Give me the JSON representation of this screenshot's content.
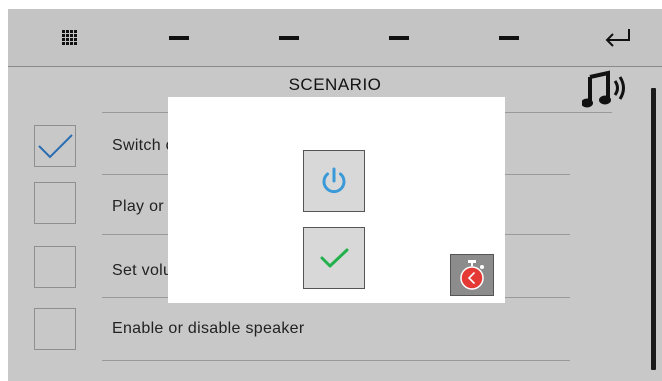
{
  "toolbar": {
    "items": [
      "grid-icon",
      "dash",
      "dash",
      "dash",
      "dash",
      "return-icon"
    ]
  },
  "header": {
    "title": "SCENARIO",
    "icon": "music-speaker-icon"
  },
  "list": {
    "items": [
      {
        "label": "Switch on or off",
        "checked": true
      },
      {
        "label": "Play or stop",
        "checked": false
      },
      {
        "label": "Set volume",
        "checked": false
      },
      {
        "label": "Enable or disable speaker",
        "checked": false
      }
    ]
  },
  "modal": {
    "buttons": [
      "power-icon",
      "confirm-check-icon",
      "timer-icon"
    ]
  },
  "colors": {
    "screen_bg": "#c8c8c8",
    "check_blue": "#2a6db0",
    "power_blue": "#3a9ad9",
    "confirm_green": "#23b14d",
    "timer_red": "#e53935"
  }
}
